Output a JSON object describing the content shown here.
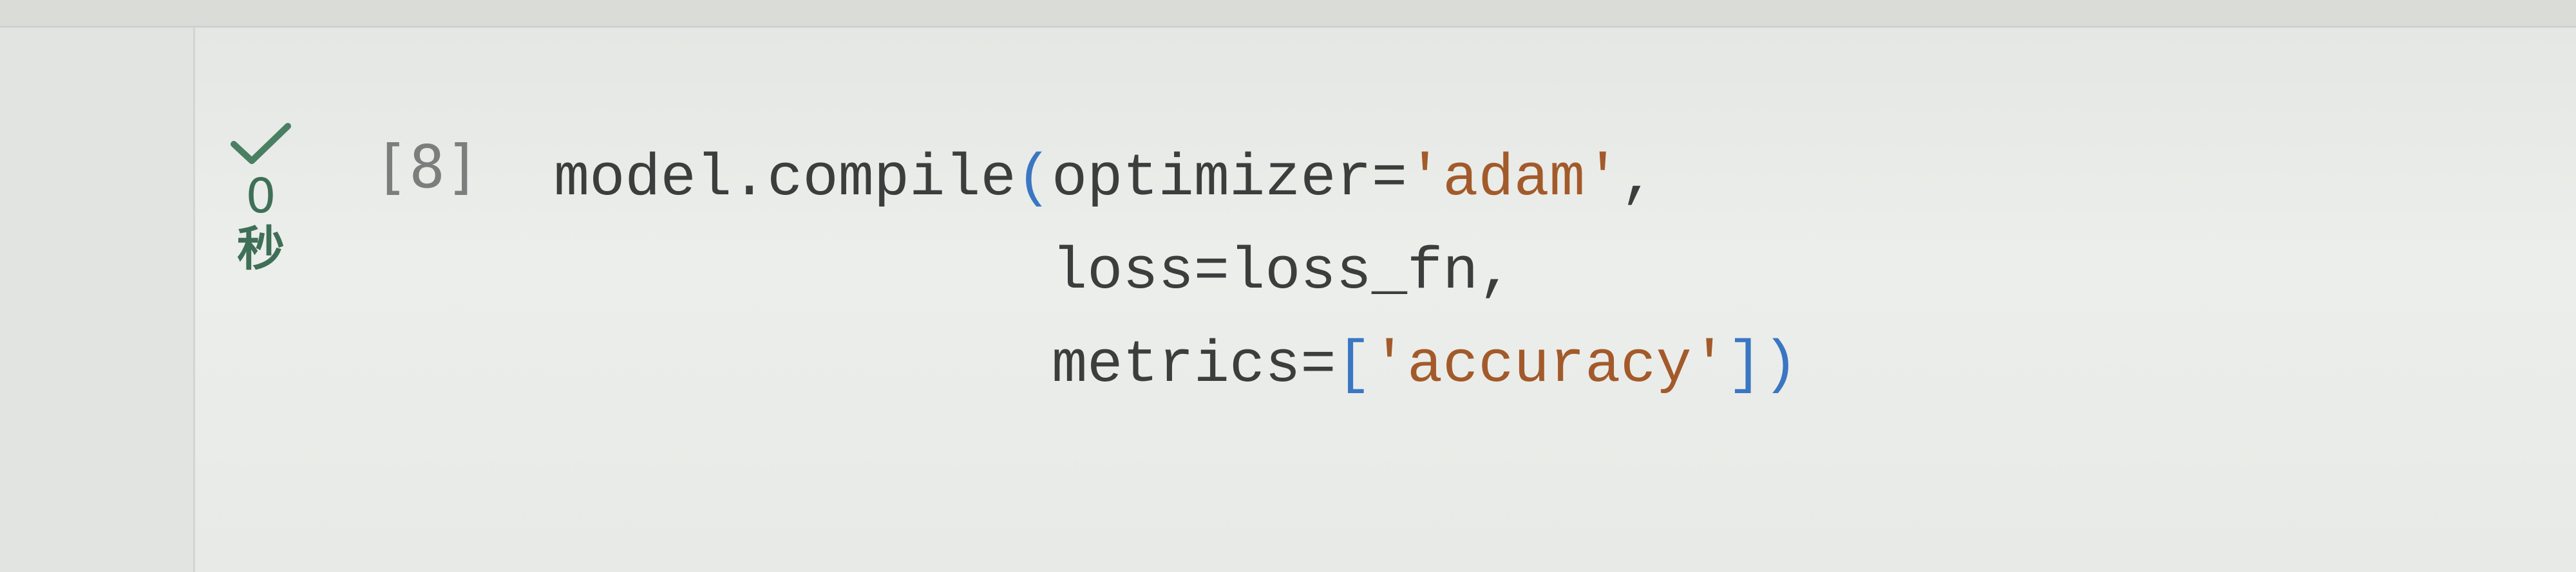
{
  "cell": {
    "status": {
      "icon": "check-icon",
      "duration_value": "0",
      "duration_unit": "秒",
      "color": "#4a7f63"
    },
    "execution_count": "[8]",
    "code_lines": [
      {
        "indent": "",
        "parts": [
          {
            "t": "model.compile",
            "k": "id"
          },
          {
            "t": "(",
            "k": "br"
          },
          {
            "t": "optimizer=",
            "k": "id"
          },
          {
            "t": "'adam'",
            "k": "str"
          },
          {
            "t": ",",
            "k": "id"
          }
        ]
      },
      {
        "indent": "              ",
        "parts": [
          {
            "t": "loss=loss_fn,",
            "k": "id"
          }
        ]
      },
      {
        "indent": "              ",
        "parts": [
          {
            "t": "metrics=",
            "k": "id"
          },
          {
            "t": "[",
            "k": "br"
          },
          {
            "t": "'accuracy'",
            "k": "str"
          },
          {
            "t": "]",
            "k": "br"
          },
          {
            "t": ")",
            "k": "br"
          }
        ]
      }
    ]
  }
}
